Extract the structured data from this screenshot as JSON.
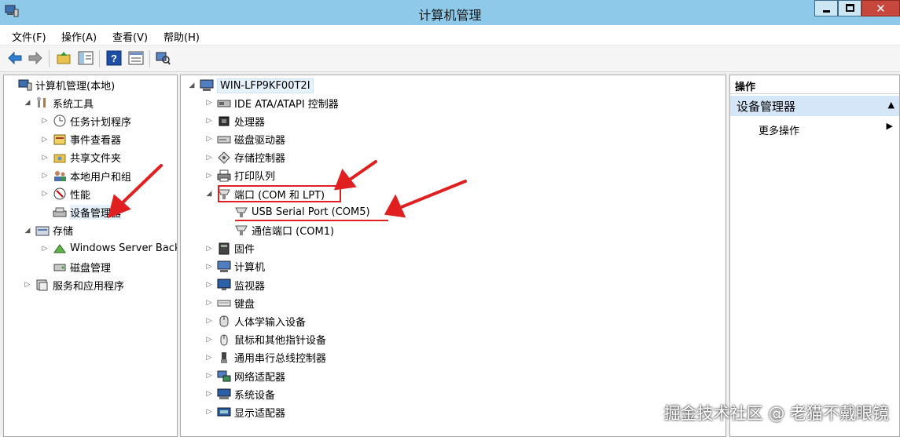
{
  "window": {
    "title": "计算机管理"
  },
  "menu": [
    "文件(F)",
    "操作(A)",
    "查看(V)",
    "帮助(H)"
  ],
  "left_tree": [
    {
      "label": "计算机管理(本地)",
      "level": 0,
      "arrow": "",
      "icon": "computer-management-icon"
    },
    {
      "label": "系统工具",
      "level": 1,
      "arrow": "expanded",
      "icon": "tools-icon"
    },
    {
      "label": "任务计划程序",
      "level": 2,
      "arrow": "collapsed",
      "icon": "clock-icon"
    },
    {
      "label": "事件查看器",
      "level": 2,
      "arrow": "collapsed",
      "icon": "event-viewer-icon"
    },
    {
      "label": "共享文件夹",
      "level": 2,
      "arrow": "collapsed",
      "icon": "shared-folder-icon"
    },
    {
      "label": "本地用户和组",
      "level": 2,
      "arrow": "collapsed",
      "icon": "users-icon"
    },
    {
      "label": "性能",
      "level": 2,
      "arrow": "collapsed",
      "icon": "performance-icon"
    },
    {
      "label": "设备管理器",
      "level": 2,
      "arrow": "",
      "icon": "device-manager-icon",
      "selected": true
    },
    {
      "label": "存储",
      "level": 1,
      "arrow": "expanded",
      "icon": "storage-icon"
    },
    {
      "label": "Windows Server Back",
      "level": 2,
      "arrow": "collapsed",
      "icon": "backup-icon"
    },
    {
      "label": "磁盘管理",
      "level": 2,
      "arrow": "",
      "icon": "disk-management-icon"
    },
    {
      "label": "服务和应用程序",
      "level": 1,
      "arrow": "collapsed",
      "icon": "services-icon"
    }
  ],
  "device_tree": {
    "root": "WIN-LFP9KF00T2I",
    "items": [
      {
        "label": "IDE ATA/ATAPI 控制器",
        "level": 1,
        "arrow": "collapsed",
        "icon": "ide-controller-icon"
      },
      {
        "label": "处理器",
        "level": 1,
        "arrow": "collapsed",
        "icon": "processor-icon"
      },
      {
        "label": "磁盘驱动器",
        "level": 1,
        "arrow": "collapsed",
        "icon": "disk-drive-icon"
      },
      {
        "label": "存储控制器",
        "level": 1,
        "arrow": "collapsed",
        "icon": "storage-controller-icon"
      },
      {
        "label": "打印队列",
        "level": 1,
        "arrow": "collapsed",
        "icon": "printer-icon"
      },
      {
        "label": "端口 (COM 和 LPT)",
        "level": 1,
        "arrow": "expanded",
        "icon": "port-icon"
      },
      {
        "label": "USB Serial Port (COM5)",
        "level": 2,
        "arrow": "",
        "icon": "port-icon"
      },
      {
        "label": "通信端口 (COM1)",
        "level": 2,
        "arrow": "",
        "icon": "port-icon"
      },
      {
        "label": "固件",
        "level": 1,
        "arrow": "collapsed",
        "icon": "firmware-icon"
      },
      {
        "label": "计算机",
        "level": 1,
        "arrow": "collapsed",
        "icon": "computer-icon"
      },
      {
        "label": "监视器",
        "level": 1,
        "arrow": "collapsed",
        "icon": "monitor-icon"
      },
      {
        "label": "键盘",
        "level": 1,
        "arrow": "collapsed",
        "icon": "keyboard-icon"
      },
      {
        "label": "人体学输入设备",
        "level": 1,
        "arrow": "collapsed",
        "icon": "hid-icon"
      },
      {
        "label": "鼠标和其他指针设备",
        "level": 1,
        "arrow": "collapsed",
        "icon": "mouse-icon"
      },
      {
        "label": "通用串行总线控制器",
        "level": 1,
        "arrow": "collapsed",
        "icon": "usb-icon"
      },
      {
        "label": "网络适配器",
        "level": 1,
        "arrow": "collapsed",
        "icon": "network-adapter-icon"
      },
      {
        "label": "系统设备",
        "level": 1,
        "arrow": "collapsed",
        "icon": "system-device-icon"
      },
      {
        "label": "显示适配器",
        "level": 1,
        "arrow": "collapsed",
        "icon": "display-adapter-icon"
      }
    ]
  },
  "actions": {
    "header": "操作",
    "section": "设备管理器",
    "item": "更多操作"
  },
  "watermark": "掘金技术社区 @ 老猫不戴眼镜",
  "colors": {
    "titlebar": "#8ec9ea",
    "annotation": "#e02020",
    "close_button": "#c7473c"
  }
}
